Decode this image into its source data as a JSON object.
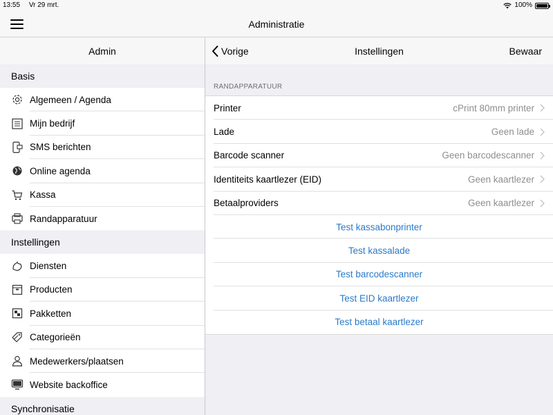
{
  "status": {
    "time": "13:55",
    "date": "Vr 29 mrt.",
    "battery": "100%"
  },
  "header": {
    "title": "Administratie"
  },
  "sidebar": {
    "title": "Admin",
    "sections": [
      {
        "label": "Basis"
      },
      {
        "label": "Instellingen"
      },
      {
        "label": "Synchronisatie"
      }
    ],
    "items": [
      {
        "label": "Algemeen / Agenda",
        "icon": "gear-icon"
      },
      {
        "label": "Mijn bedrijf",
        "icon": "list-icon"
      },
      {
        "label": "SMS berichten",
        "icon": "sms-icon"
      },
      {
        "label": "Online agenda",
        "icon": "globe-icon"
      },
      {
        "label": "Kassa",
        "icon": "cart-icon"
      },
      {
        "label": "Randapparatuur",
        "icon": "printer-icon"
      },
      {
        "label": "Diensten",
        "icon": "hand-icon"
      },
      {
        "label": "Producten",
        "icon": "box-icon"
      },
      {
        "label": "Pakketten",
        "icon": "package-icon"
      },
      {
        "label": "Categorieën",
        "icon": "tags-icon"
      },
      {
        "label": "Medewerkers/plaatsen",
        "icon": "person-icon"
      },
      {
        "label": "Website backoffice",
        "icon": "monitor-icon"
      }
    ]
  },
  "detail": {
    "back_label": "Vorige",
    "title": "Instellingen",
    "save_label": "Bewaar",
    "group_label": "RANDAPPARATUUR",
    "rows": [
      {
        "label": "Printer",
        "value": "cPrint 80mm printer"
      },
      {
        "label": "Lade",
        "value": "Geen lade"
      },
      {
        "label": "Barcode scanner",
        "value": "Geen barcodescanner"
      },
      {
        "label": "Identiteits kaartlezer (EID)",
        "value": "Geen kaartlezer"
      },
      {
        "label": "Betaalproviders",
        "value": "Geen kaartlezer"
      }
    ],
    "actions": [
      "Test kassabonprinter",
      "Test kassalade",
      "Test barcodescanner",
      "Test EID kaartlezer",
      "Test betaal kaartlezer"
    ]
  },
  "colors": {
    "accent": "#2a7ac9",
    "secondary_text": "#8e8e93",
    "background": "#efeff4"
  }
}
